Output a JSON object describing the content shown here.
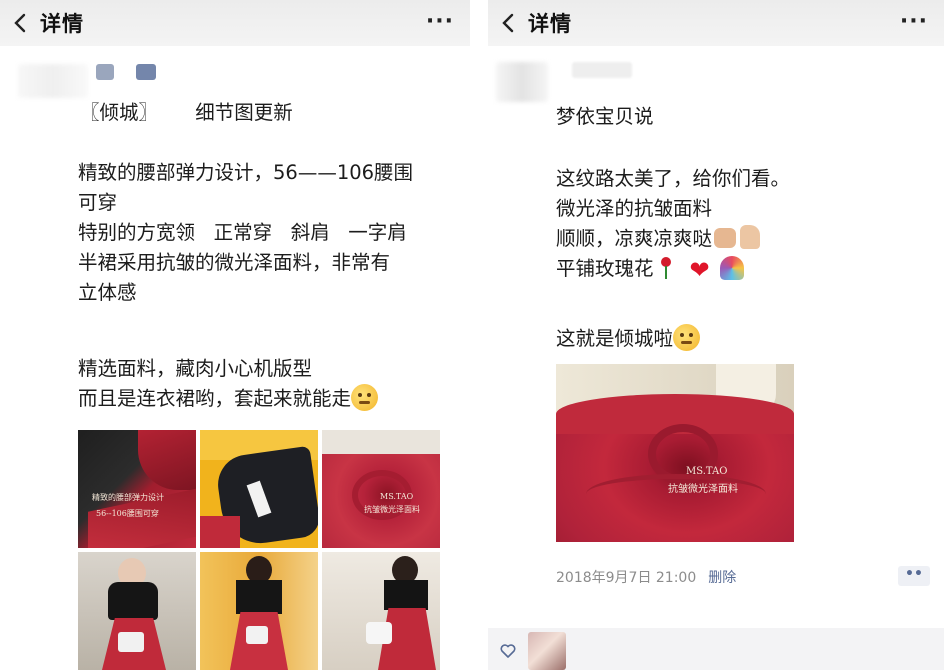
{
  "left": {
    "nav": {
      "title": "详情",
      "more": "···"
    },
    "post": {
      "heading_tag": "〖倾城〗",
      "heading_text": "细节图更新",
      "lines": [
        "精致的腰部弹力设计，56——106腰围",
        "可穿",
        "特别的方宽领   正常穿   斜肩   一字肩",
        "半裙采用抗皱的微光泽面料，非常有",
        "立体感"
      ],
      "lines2": [
        "精选面料，藏肉小心机版型",
        "而且是连衣裙哟，套起来就能走"
      ],
      "photo1_wm_a": "精致的腰部弹力设计",
      "photo1_wm_b": "56--106腰围可穿",
      "photo3_wm_a": "MS.TAO",
      "photo3_wm_b": "抗皱微光泽面料"
    }
  },
  "right": {
    "nav": {
      "title": "详情",
      "more": "···"
    },
    "post": {
      "author_line": "梦依宝贝说",
      "lines": [
        "这纹路太美了，给你们看。",
        "微光泽的抗皱面料",
        "顺顺，凉爽凉爽哒",
        "平铺玫瑰花"
      ],
      "line_last": "这就是倾城啦",
      "photo_wm_a": "MS.TAO",
      "photo_wm_b": "抗皱微光泽面料",
      "timestamp": "2018年9月7日 21:00",
      "delete_label": "删除",
      "action_dots": "••"
    }
  },
  "colors": {
    "link": "#576b95",
    "muted": "#8c8c8c",
    "skirt_red": "#c3283c",
    "accent_yellow": "#f1b31c"
  }
}
